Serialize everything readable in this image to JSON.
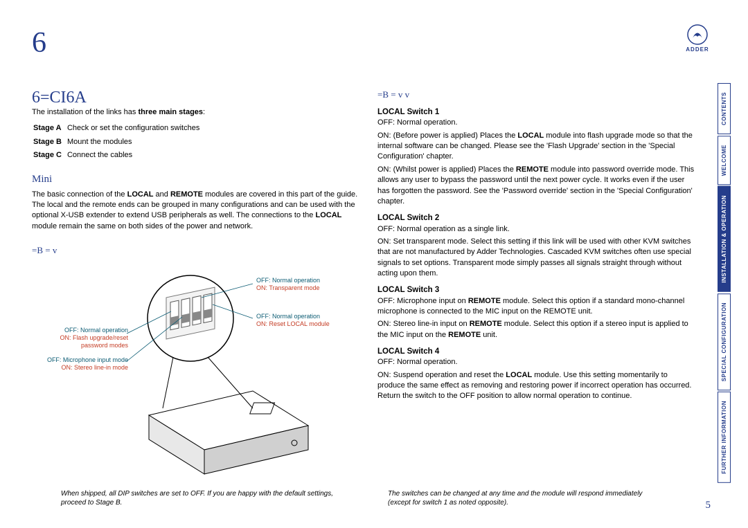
{
  "page_number_top": "6",
  "page_number_bottom": "5",
  "logo_text": "ADDER",
  "main_title": "6=CI6A",
  "intro": {
    "line": "The installation of the links has three main stages:",
    "stages": [
      [
        "Stage A",
        "Check or set the configuration switches"
      ],
      [
        "Stage B",
        "Mount the modules"
      ],
      [
        "Stage C",
        "Connect the cables"
      ]
    ]
  },
  "mini_title_left": "Mini",
  "body_left": "The basic connection of the LOCAL and REMOTE modules are covered in this part of the guide. The local and the remote ends can be grouped in many configurations and can be used with the optional X-USB extender to extend USB peripherals as well. The connections to the LOCAL module remain the same on both sides of the power and network.",
  "subhead_a": "=B = v",
  "diagram_labels": {
    "l1a": "OFF: Normal operation",
    "l1b": "ON: Flash upgrade/reset password modes",
    "l2a": "OFF: Microphone input mode",
    "l2b": "ON: Stereo line-in mode",
    "r1a": "OFF: Normal operation",
    "r1b": "ON: Transparent mode",
    "r2a": "OFF: Normal operation",
    "r2b": "ON: Reset LOCAL module"
  },
  "right_heading": "=B = v v",
  "switches": {
    "s1": {
      "title": "LOCAL Switch 1",
      "off": "OFF: Normal operation.",
      "on1": "ON: (Before power is applied) Places the LOCAL module into flash upgrade mode so that the internal software can be changed. Please see the 'Flash Upgrade' section in the 'Special Configuration' chapter.",
      "on2": "ON: (Whilst power is applied) Places the REMOTE module into password override mode. This allows any user to bypass the password until the next power cycle. It works even if the user has forgotten the password. See the 'Password override' section in the 'Special Configuration' chapter."
    },
    "s2": {
      "title": "LOCAL Switch 2",
      "off": "OFF: Normal operation as a single link.",
      "on": "ON: Set transparent mode. Select this setting if this link will be used with other KVM switches that are not manufactured by Adder Technologies. Cascaded KVM switches often use special signals to set options. Transparent mode simply passes all signals straight through without acting upon them."
    },
    "s3": {
      "title": "LOCAL Switch 3",
      "off": "OFF: Microphone input on REMOTE module. Select this option if a standard mono-channel microphone is connected to the MIC input on the REMOTE unit.",
      "on": "ON: Stereo line-in input on REMOTE module. Select this option if a stereo input is applied to the MIC input on the REMOTE unit."
    },
    "s4": {
      "title": "LOCAL Switch 4",
      "off": "OFF: Normal operation.",
      "on": "ON: Suspend operation and reset the LOCAL module. Use this setting momentarily to produce the same effect as removing and restoring power if incorrect operation has occurred. Return the switch to the OFF position to allow normal operation to continue."
    }
  },
  "footer_left": "When shipped, all DIP switches are set to OFF. If you are happy with the default settings, proceed to Stage B.",
  "footer_right": "The switches can be changed at any time and the module will respond immediately (except for switch 1 as noted opposite).",
  "tabs": [
    "CONTENTS",
    "WELCOME",
    "INSTALLATION & OPERATION",
    "SPECIAL CONFIGURATION",
    "FURTHER INFORMATION"
  ]
}
